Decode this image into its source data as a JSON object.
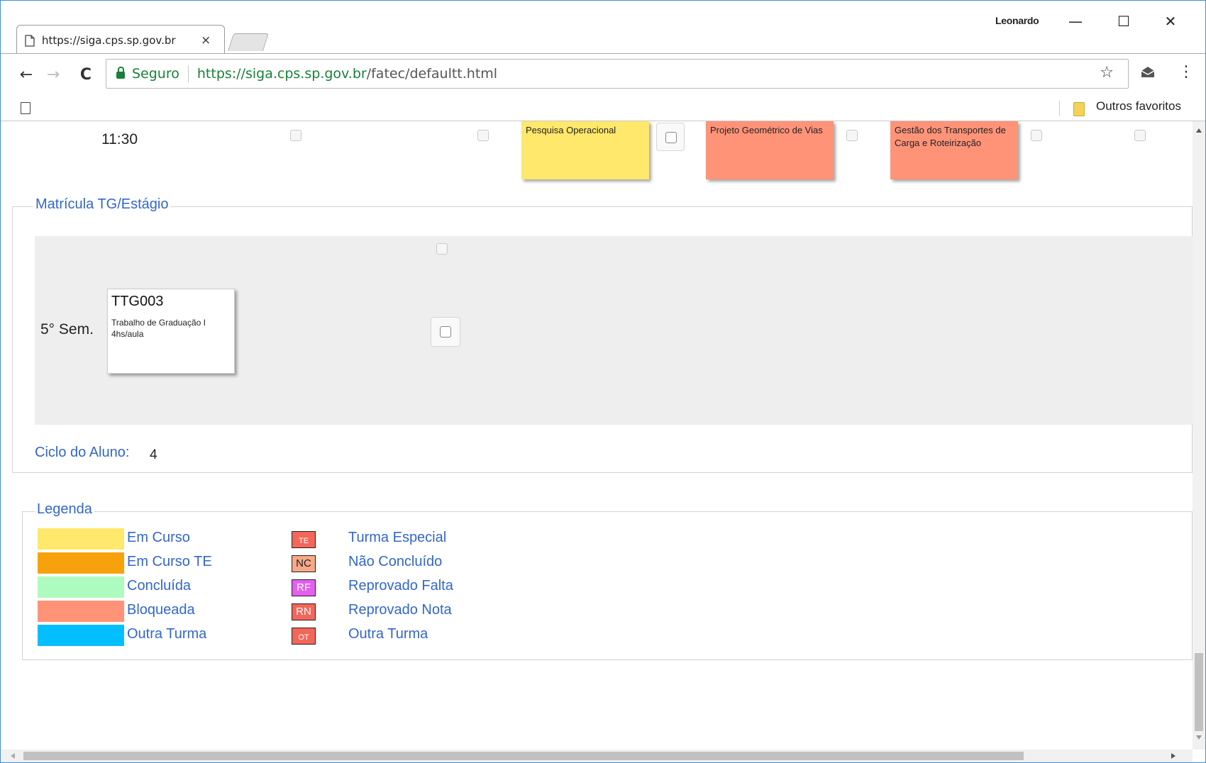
{
  "browser": {
    "tab_title": "https://siga.cps.sp.gov.br",
    "tab_close": "×",
    "user_name": "Leonardo",
    "minimize": "—",
    "maximize": "☐",
    "close": "✕",
    "back": "←",
    "forward": "→",
    "reload": "C",
    "secure_label": "Seguro",
    "url_host": "https://siga.cps.sp.gov.br",
    "url_path": "/fatec/defaultt.html",
    "star": "☆",
    "menu": "⋮",
    "bookmark_folder": "Outros favoritos"
  },
  "schedule": {
    "time": "11:30",
    "cards": [
      {
        "name": "Pesquisa Operacional",
        "status": "Em Curso",
        "color": "#ffe86b"
      },
      {
        "name": "Projeto Geométrico de Vias",
        "status": "Bloqueada",
        "color": "#fe9378"
      },
      {
        "name": "Gestão dos Transportes de Carga e Roteirização",
        "status": "Bloqueada",
        "color": "#fe9378"
      }
    ]
  },
  "matricula": {
    "title": "Matrícula TG/Estágio",
    "semester": "5° Sem.",
    "course": {
      "code": "TTG003",
      "name": "Trabalho de Graduação I",
      "hours": "4hs/aula"
    },
    "ciclo_label": "Ciclo do Aluno:",
    "ciclo_value": "4"
  },
  "legenda": {
    "title": "Legenda",
    "colors": [
      {
        "label": "Em Curso",
        "color": "#ffe86b"
      },
      {
        "label": "Em Curso TE",
        "color": "#f7a20c"
      },
      {
        "label": "Concluída",
        "color": "#aefbbf"
      },
      {
        "label": "Bloqueada",
        "color": "#fe9378"
      },
      {
        "label": "Outra Turma",
        "color": "#03bfff"
      }
    ],
    "codes": [
      {
        "code": "TE",
        "label": "Turma Especial",
        "color": "#f2675a",
        "text_color": "#ffffff"
      },
      {
        "code": "NC",
        "label": "Não Concluído",
        "color": "#f7a987",
        "text_color": "#222222"
      },
      {
        "code": "RF",
        "label": "Reprovado Falta",
        "color": "#e35fef",
        "text_color": "#ffffff"
      },
      {
        "code": "RN",
        "label": "Reprovado Nota",
        "color": "#f2675a",
        "text_color": "#ffffff"
      },
      {
        "code": "OT",
        "label": "Outra Turma",
        "color": "#f2675a",
        "text_color": "#ffffff"
      }
    ]
  }
}
